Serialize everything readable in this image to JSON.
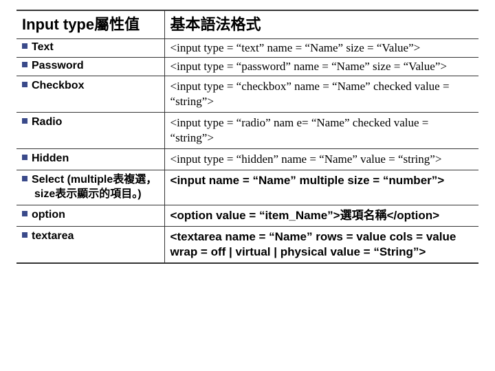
{
  "headers": {
    "left": "Input type屬性值",
    "right": "基本語法格式"
  },
  "rows": [
    {
      "label": "Text",
      "syntax": "<input type = “text” name = “Name” size = “Value”>",
      "bold": false
    },
    {
      "label": "Password",
      "syntax": "<input type = “password” name = “Name” size = “Value”>",
      "bold": false
    },
    {
      "label": "Checkbox",
      "syntax": "<input type = “checkbox” name = “Name” checked value = “string”>",
      "bold": false
    },
    {
      "label": "Radio",
      "syntax": "<input type = “radio” nam e= “Name” checked value = “string”>",
      "bold": false
    },
    {
      "label": "Hidden",
      "syntax": "<input type = “hidden” name = “Name” value = “string”>",
      "bold": false
    },
    {
      "label": "Select (multiple表複選，size表示顯示的項目。)",
      "syntax": "<input name = “Name” multiple size = “number”>",
      "bold": true
    },
    {
      "label": "option",
      "syntax": "<option value = “item_Name”>選項名稱</option>",
      "bold": true
    },
    {
      "label": "textarea",
      "syntax": "<textarea name = “Name” rows = value cols = value wrap = off | virtual | physical value = “String”>",
      "bold": true
    }
  ]
}
